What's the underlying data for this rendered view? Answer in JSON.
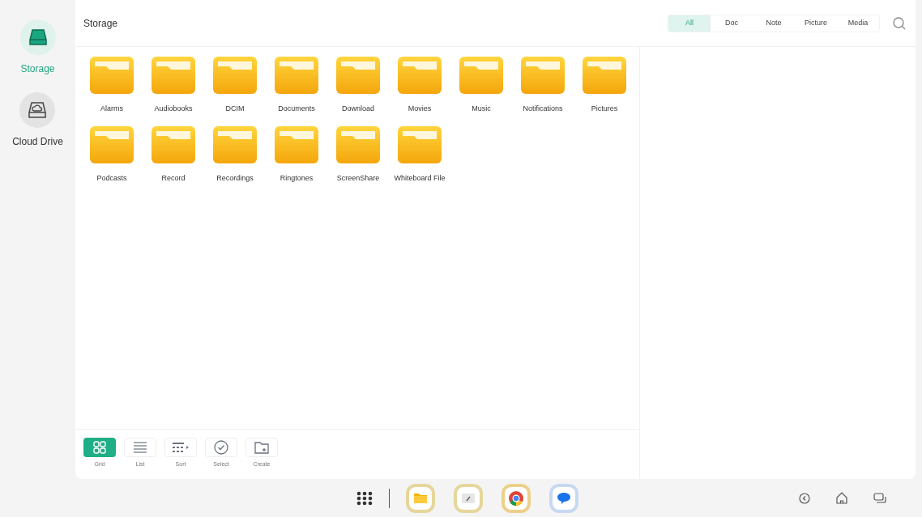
{
  "sidebar": {
    "items": [
      {
        "kind": "storage",
        "label": "Storage",
        "selected": true
      },
      {
        "kind": "cloud",
        "label": "Cloud Drive",
        "selected": false
      }
    ]
  },
  "header": {
    "title": "Storage"
  },
  "filters": [
    {
      "label": "All",
      "selected": true
    },
    {
      "label": "Doc",
      "selected": false
    },
    {
      "label": "Note",
      "selected": false
    },
    {
      "label": "Picture",
      "selected": false
    },
    {
      "label": "Media",
      "selected": false
    }
  ],
  "folders": [
    "Alarms",
    "Audiobooks",
    "DCIM",
    "Documents",
    "Download",
    "Movies",
    "Music",
    "Notifications",
    "Pictures",
    "Podcasts",
    "Record",
    "Recordings",
    "Ringtones",
    "ScreenShare",
    "Whiteboard File"
  ],
  "toolbar": [
    {
      "kind": "grid",
      "label": "Grid",
      "selected": true
    },
    {
      "kind": "list",
      "label": "List",
      "selected": false
    },
    {
      "kind": "sort",
      "label": "Sort",
      "selected": false
    },
    {
      "kind": "select",
      "label": "Select",
      "selected": false
    },
    {
      "kind": "create",
      "label": "Create",
      "selected": false
    }
  ],
  "taskbar": {
    "apps": [
      {
        "kind": "files"
      },
      {
        "kind": "whiteboard"
      },
      {
        "kind": "browser"
      },
      {
        "kind": "chat"
      }
    ]
  }
}
